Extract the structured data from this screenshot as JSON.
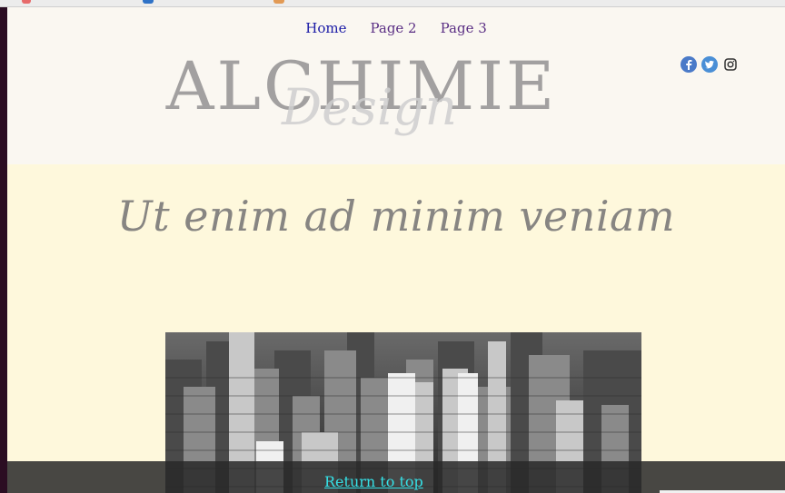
{
  "nav": {
    "items": [
      {
        "label": "Home",
        "active": true
      },
      {
        "label": "Page 2",
        "active": false
      },
      {
        "label": "Page 3",
        "active": false
      }
    ]
  },
  "social": {
    "icons": [
      "facebook-icon",
      "twitter-icon",
      "instagram-icon"
    ]
  },
  "logo": {
    "main_text": "ALCHIMIE",
    "sub_text": "Design"
  },
  "main": {
    "headline": "Ut enim ad minim veniam",
    "image_alt": "Black and white aerial view of city skyscrapers"
  },
  "footer": {
    "return_label": "Return to top"
  },
  "colors": {
    "nav_active": "#1a1aa6",
    "nav_link": "#5a2e84",
    "main_background": "#fef8dc",
    "header_background": "#faf7f1",
    "return_link": "#35e0e6"
  }
}
